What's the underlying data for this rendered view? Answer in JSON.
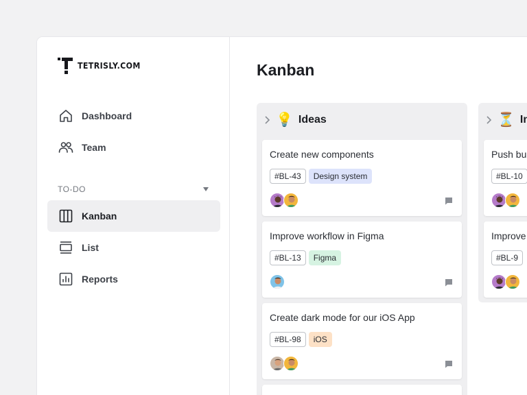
{
  "brand": {
    "name": "TETRISLY.COM"
  },
  "nav": {
    "primary": [
      {
        "label": "Dashboard",
        "icon": "home-icon"
      },
      {
        "label": "Team",
        "icon": "users-icon"
      }
    ],
    "section_title": "TO-DO",
    "section_items": [
      {
        "label": "Kanban",
        "icon": "columns-icon",
        "active": true
      },
      {
        "label": "List",
        "icon": "list-icon",
        "active": false
      },
      {
        "label": "Reports",
        "icon": "chart-icon",
        "active": false
      }
    ]
  },
  "page": {
    "title": "Kanban"
  },
  "columns": [
    {
      "title": "Ideas",
      "emoji": "💡",
      "cards": [
        {
          "title": "Create new components",
          "id": "#BL-43",
          "tag": "Design system",
          "tag_color": "#dde3fb",
          "avatars": [
            "#b57bc9",
            "#f2b63c"
          ]
        },
        {
          "title": "Improve workflow in Figma",
          "id": "#BL-13",
          "tag": "Figma",
          "tag_color": "#d6f3e2",
          "avatars": [
            "#7fc3e8"
          ]
        },
        {
          "title": "Create dark mode for our iOS App",
          "id": "#BL-98",
          "tag": "iOS",
          "tag_color": "#fde1c6",
          "avatars": [
            "#c9b6a6",
            "#f2b63c"
          ]
        }
      ]
    },
    {
      "title": "In",
      "emoji": "⏳",
      "cards": [
        {
          "title": "Push bu",
          "id": "#BL-10",
          "avatars": [
            "#b57bc9",
            "#f2b63c"
          ]
        },
        {
          "title": "Improve",
          "id": "#BL-9",
          "avatars": [
            "#b57bc9",
            "#f2b63c"
          ]
        }
      ]
    }
  ]
}
